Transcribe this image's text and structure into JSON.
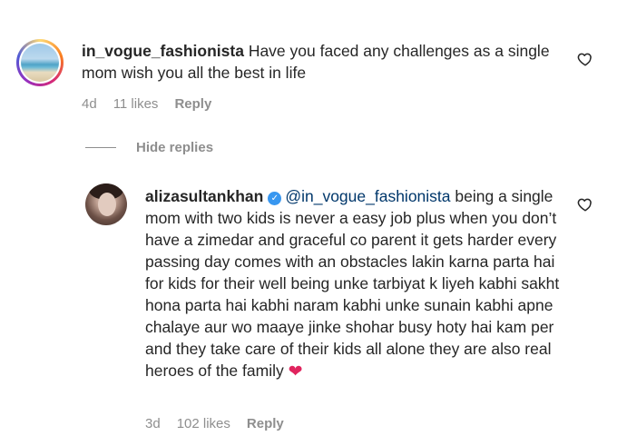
{
  "comment1": {
    "username": "in_vogue_fashionista",
    "text": "Have you faced any challenges as a single mom wish you all the best in life",
    "time": "4d",
    "likes": "11 likes",
    "reply_label": "Reply",
    "avatar_icon": "beach-avatar"
  },
  "replies_toggle": {
    "label": "Hide replies"
  },
  "comment2": {
    "username": "alizasultankhan",
    "verified": true,
    "mention": "@in_vogue_fashionista",
    "text": "being a single mom with two kids is never a easy job plus when you don’t have a zimedar and graceful co parent it gets harder every passing day comes with an obstacles lakin karna parta hai for kids for their well being unke tarbiyat k liyeh kabhi sakht hona parta hai kabhi naram kabhi unke sunain kabhi apne chalaye aur wo maaye jinke shohar busy hoty hai kam per and they take care of their kids all alone they are also real heroes of the family",
    "emoji": "❤",
    "time": "3d",
    "likes": "102 likes",
    "reply_label": "Reply",
    "avatar_icon": "portrait-avatar"
  },
  "colors": {
    "text": "#262626",
    "meta": "#8e8e8e",
    "mention": "#00376b",
    "verified": "#3897f0",
    "heart": "#e0245e"
  }
}
